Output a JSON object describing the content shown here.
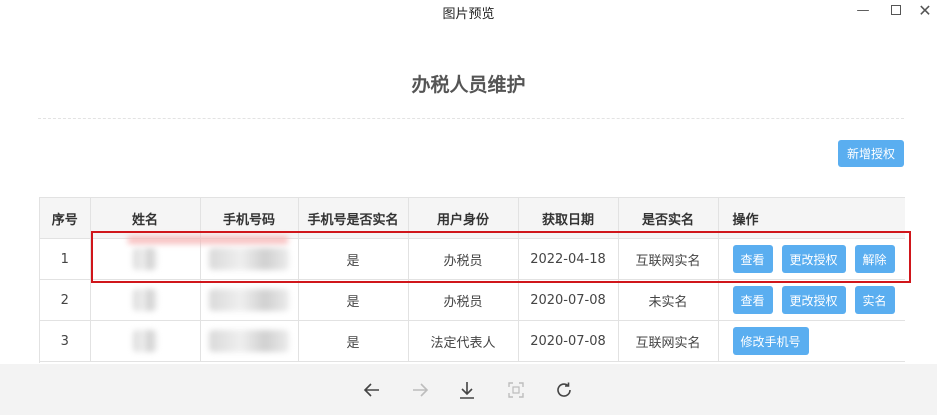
{
  "window": {
    "title": "图片预览",
    "controls": [
      "minimize-icon",
      "maximize-icon",
      "close-icon"
    ]
  },
  "page": {
    "heading": "办税人员维护",
    "add_button": "新增授权"
  },
  "table": {
    "headers": [
      "序号",
      "姓名",
      "手机号码",
      "手机号是否实名",
      "用户身份",
      "获取日期",
      "是否实名",
      "操作"
    ],
    "rows": [
      {
        "index": "1",
        "name": "",
        "phone": "",
        "phone_verified": "是",
        "role": "办税员",
        "date": "2022-04-18",
        "real_name": "互联网实名",
        "actions": [
          "查看",
          "更改授权",
          "解除"
        ]
      },
      {
        "index": "2",
        "name": "",
        "phone": "",
        "phone_verified": "是",
        "role": "办税员",
        "date": "2020-07-08",
        "real_name": "未实名",
        "actions": [
          "查看",
          "更改授权",
          "实名"
        ]
      },
      {
        "index": "3",
        "name": "",
        "phone": "",
        "phone_verified": "是",
        "role": "法定代表人",
        "date": "2020-07-08",
        "real_name": "互联网实名",
        "actions": [
          "修改手机号"
        ]
      }
    ]
  },
  "viewer_toolbar": {
    "icons": [
      "arrow-left-icon",
      "arrow-right-icon",
      "download-icon",
      "fit-screen-icon",
      "rotate-icon"
    ],
    "disabled": [
      "arrow-right-icon",
      "fit-screen-icon"
    ]
  },
  "colors": {
    "button": "#5aaef0",
    "highlight_border": "#d0161b",
    "header_bg": "#f5f5f5"
  }
}
